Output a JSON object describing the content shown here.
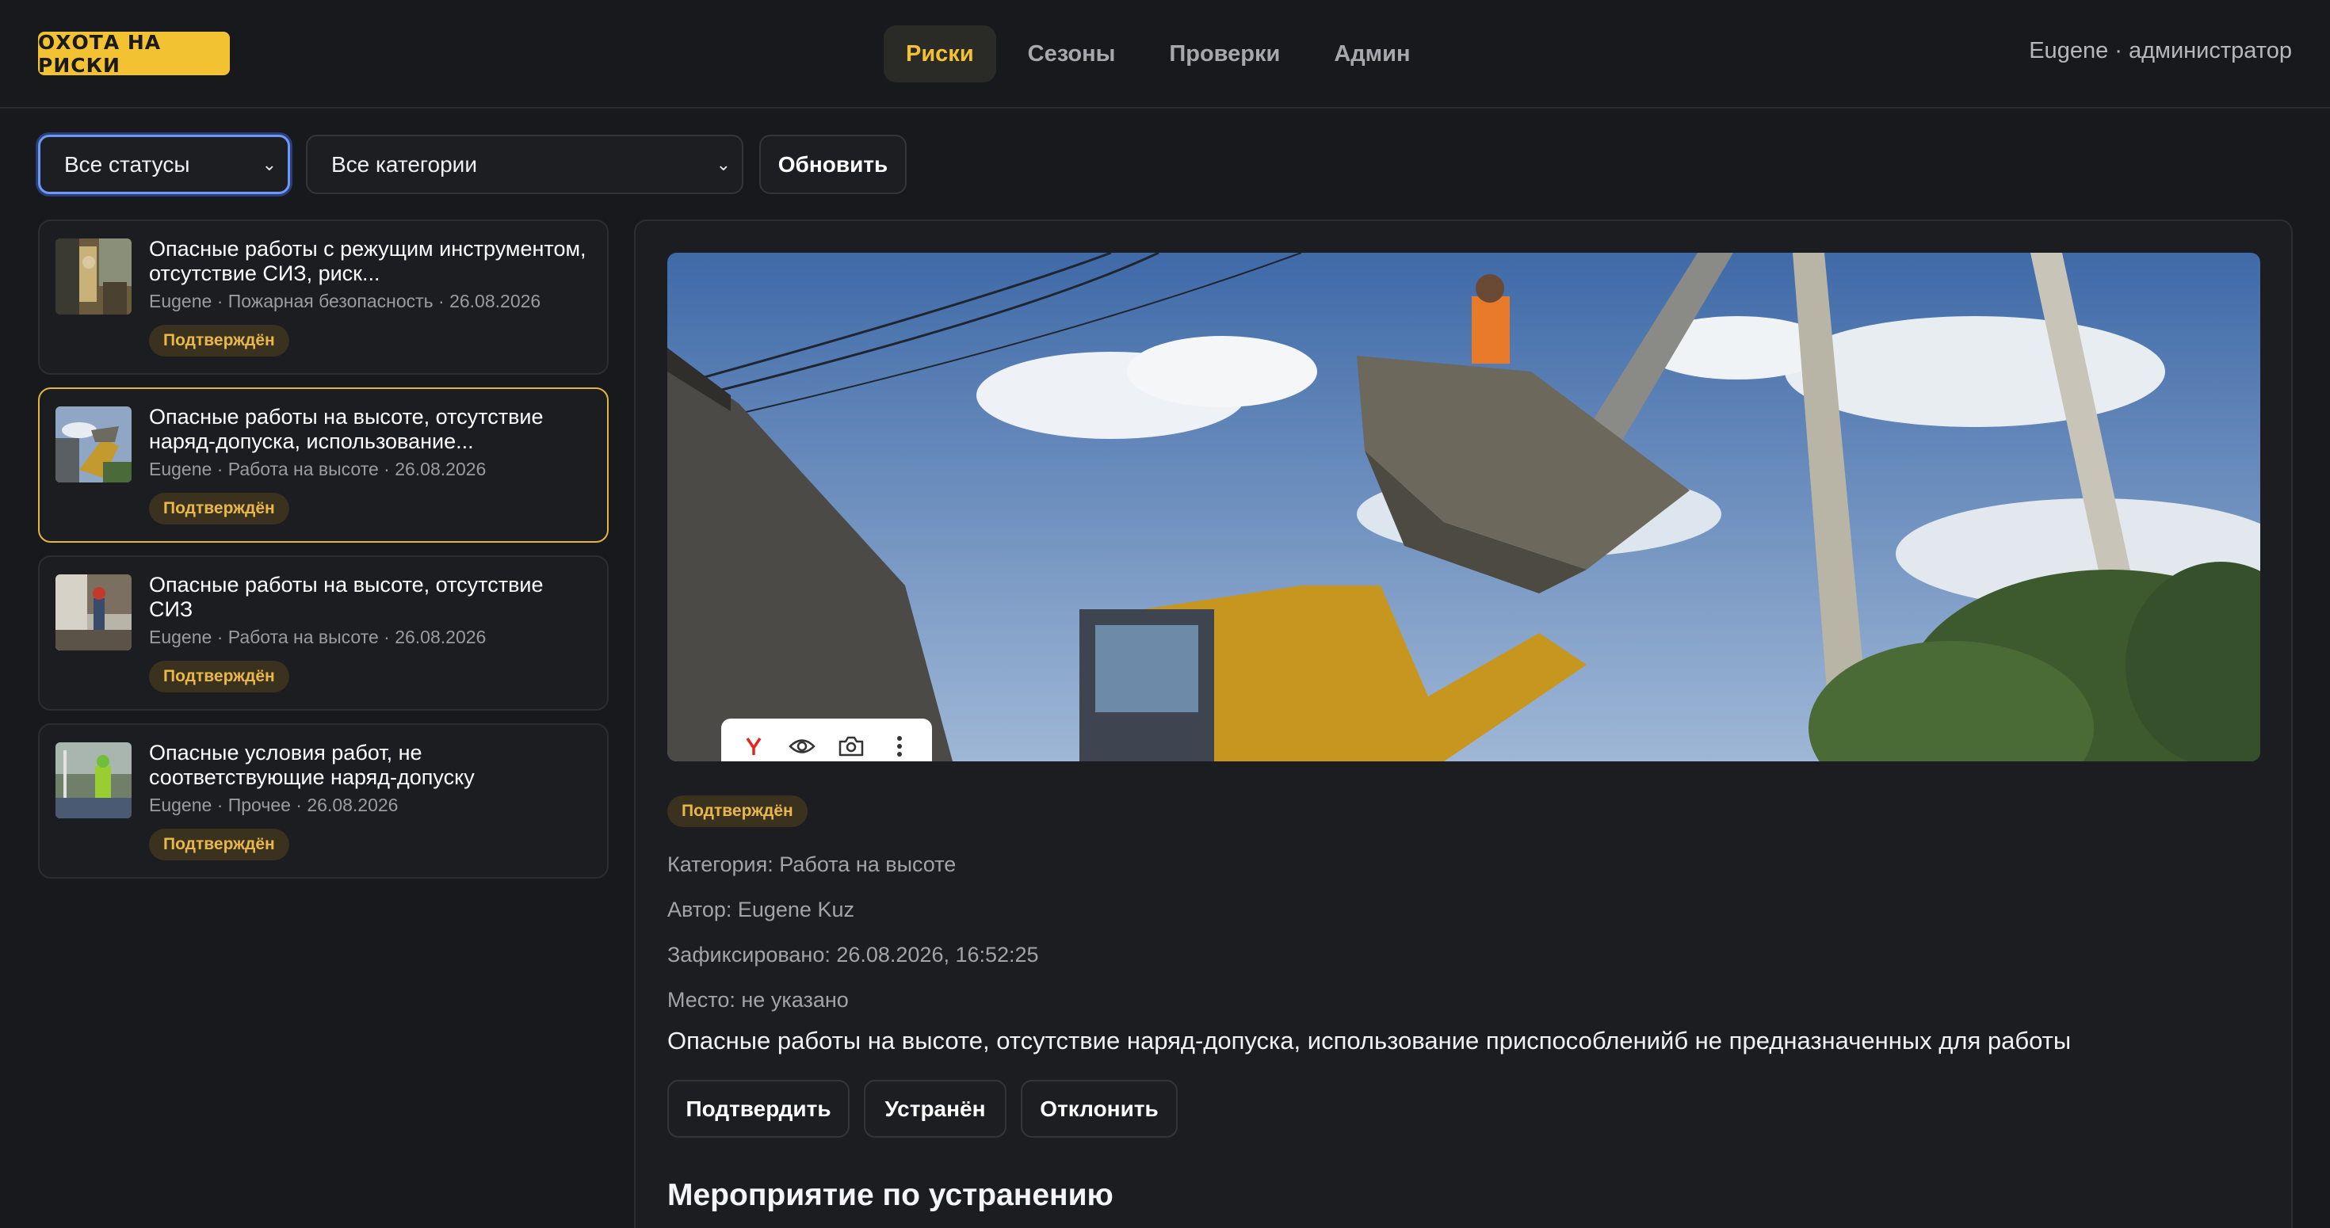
{
  "header": {
    "logo": "ОХОТА НА РИСКИ",
    "nav": [
      "Риски",
      "Сезоны",
      "Проверки",
      "Админ"
    ],
    "active_nav": "Риски",
    "user": "Eugene · администратор"
  },
  "filters": {
    "status": "Все статусы",
    "category": "Все категории",
    "refresh": "Обновить"
  },
  "risks": [
    {
      "title": "Опасные работы с режущим инструментом, отсутствие СИЗ, риск...",
      "meta": "Eugene · Пожарная безопасность · 26.08.2026",
      "status": "Подтверждён"
    },
    {
      "title": "Опасные работы на высоте, отсутствие наряд-допуска, использование...",
      "meta": "Eugene · Работа на высоте · 26.08.2026",
      "status": "Подтверждён"
    },
    {
      "title": "Опасные работы на высоте, отсутствие СИЗ",
      "meta": "Eugene · Работа на высоте · 26.08.2026",
      "status": "Подтверждён"
    },
    {
      "title": "Опасные условия работ, не соответствующие наряд-допуску",
      "meta": "Eugene · Прочее · 26.08.2026",
      "status": "Подтверждён"
    }
  ],
  "detail": {
    "status": "Подтверждён",
    "category": "Категория: Работа на высоте",
    "author": "Автор: Eugene Kuz",
    "recorded": "Зафиксировано: 26.08.2026, 16:52:25",
    "place": "Место: не указано",
    "description": "Опасные работы на высоте, отсутствие наряд-допуска, использование приспособленийб не предназначенных для работы",
    "actions": [
      "Подтвердить",
      "Устранён",
      "Отклонить"
    ],
    "section_title": "Мероприятие по устранению",
    "toolbar_icons": [
      "yandex-icon",
      "eye-icon",
      "camera-search-icon",
      "more-icon"
    ]
  }
}
